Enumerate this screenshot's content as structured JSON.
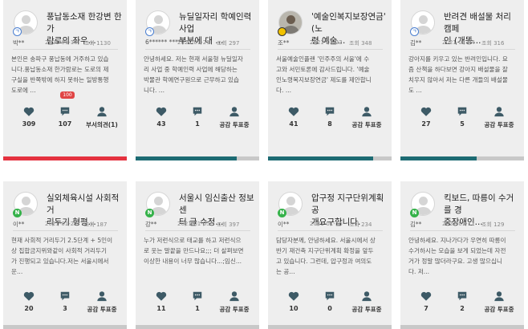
{
  "colors": {
    "heart": "#3d5a66",
    "comment": "#3d5a66",
    "person": "#3d5a66",
    "progress_red": "#e5323f",
    "progress_teal": "#1d6b73"
  },
  "icons": {
    "like": "heart-icon",
    "comment": "comment-icon",
    "vote": "person-icon"
  },
  "cards": [
    {
      "title": "풍납동소재 한강변 한가\n람로의 좌우...",
      "author": "박**",
      "date": "2021-01-10",
      "views": "조회 1130",
      "excerpt": "본인은 송파구 풍납동에 거주하고 있습\n니다.풍납동소재 한가람로는 도로의 제\n구실을 반쪽밖에 하지 못하는 일방통행\n도로에 ...",
      "badge": "100",
      "likes": "309",
      "comments": "107",
      "vote_label": "부서의견(1)",
      "avatar_badge": "blue",
      "progress": 1.0,
      "progress_color": "#e5323f"
    },
    {
      "title": "뉴딜일자리 학예인력사업\n부분에 대 ...",
      "author": "6******\n*****",
      "date": "2021-01-21",
      "views": "조회 297",
      "excerpt": "안녕하세요. 저는 현재 서울형 뉴딜일자\n리 사업 중 학예인력 사업에 해당하는\n박물관 학예연구원으로 근무하고 있습\n니다. ...",
      "likes": "43",
      "comments": "1",
      "vote_label": "공감 투표중",
      "avatar_badge": "blue",
      "progress": 0.82,
      "progress_color": "#1d6b73"
    },
    {
      "title": "'예술인복지보장연금' (노\n령 예술...",
      "author": "조**",
      "date": "2021-01-23",
      "views": "조회 348",
      "excerpt": "서울예술인플랜 '민주주의 서울'에 수\n고와 서민토론에 감사드립니다. '예술\n인노령복지보장연금' 제도를 제안합니\n다. ...",
      "likes": "41",
      "comments": "8",
      "vote_label": "공감 투표중",
      "avatar_badge": "yellow",
      "avatar_photo": true,
      "progress": 0.85,
      "progress_color": "#1d6b73"
    },
    {
      "title": "반려견 배설물 처리 캠페\n인 (개똥...",
      "author": "김**",
      "date": "2021-01-04",
      "views": "조회 316",
      "excerpt": "강아지를 키우고 있는 반려인입니다. 요\n즘 산책을 하다보면 강아지 배설물을 잘\n치우지 않아서 저는 다른 개들의 배설물\n도 ...",
      "likes": "27",
      "comments": "5",
      "vote_label": "공감 투표중",
      "avatar_badge": "blue",
      "progress": 0.62,
      "progress_color": "#1d6b73"
    },
    {
      "title": "실외체육시설 사회적 거\n리두기 형평...",
      "author": "이**",
      "date": "2021-01-27",
      "views": "조회 187",
      "excerpt": "현재 사회적 거리두기 2.5단계 + 5인이\n상 집합금지위와같이 사회적 거리두기\n가 진행되고 있습니다.저는 서울시에서\n운...",
      "likes": "20",
      "comments": "3",
      "vote_label": "공감 투표중",
      "avatar_badge": "green",
      "progress": 0,
      "progress_color": "#1d6b73"
    },
    {
      "title": "서울시 임신출산 정보센\n터 글 수정...",
      "author": "강**",
      "date": "2021-01-05",
      "views": "조회 397",
      "excerpt": "누가 저런식으로 태교를 하고 저런식으\n로 웃는 말끝을 만드나요;;; 더 살펴보면\n이상한 내용이 너무 많습니다...;임신...",
      "likes": "11",
      "comments": "1",
      "vote_label": "공감 투표중",
      "avatar_badge": "green",
      "progress": 0,
      "progress_color": "#1d6b73"
    },
    {
      "title": "압구정 지구단위계획 공\n개요구합니다.",
      "author": "이**",
      "date": "2021-01-16",
      "views": "조회 234",
      "excerpt": "담당자분께, 안녕하세요. 서울시에서 상\n반기 재건축 지구단위계획 확정을 앞두\n고 있습니다. 그런데, 압구정과 여의도\n는 공...",
      "likes": "10",
      "comments": "0",
      "vote_label": "공감 투표중",
      "avatar_badge": "green",
      "progress": 0,
      "progress_color": "#1d6b73"
    },
    {
      "title": "킥보드, 따릉이 수거를 경\n중장애인...",
      "author": "김**",
      "date": "2021-01-11",
      "views": "조회 129",
      "excerpt": "안녕하세요. 지나가다가 우연히 따릉이\n수거하시는 모습을 보게 되었는데 자전\n거가 정말 많더라구요. 고생 많으십니\n다. 저...",
      "likes": "7",
      "comments": "2",
      "vote_label": "공감 투표중",
      "avatar_badge": "green",
      "progress": 0,
      "progress_color": "#1d6b73"
    }
  ]
}
